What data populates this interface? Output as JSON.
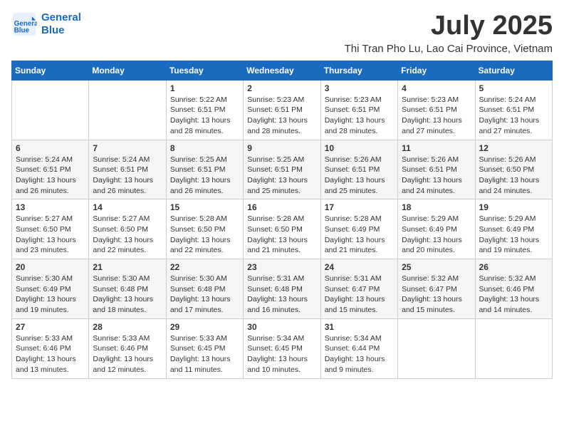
{
  "logo": {
    "line1": "General",
    "line2": "Blue"
  },
  "title": "July 2025",
  "subtitle": "Thi Tran Pho Lu, Lao Cai Province, Vietnam",
  "weekdays": [
    "Sunday",
    "Monday",
    "Tuesday",
    "Wednesday",
    "Thursday",
    "Friday",
    "Saturday"
  ],
  "weeks": [
    [
      {
        "day": "",
        "info": ""
      },
      {
        "day": "",
        "info": ""
      },
      {
        "day": "1",
        "info": "Sunrise: 5:22 AM\nSunset: 6:51 PM\nDaylight: 13 hours and 28 minutes."
      },
      {
        "day": "2",
        "info": "Sunrise: 5:23 AM\nSunset: 6:51 PM\nDaylight: 13 hours and 28 minutes."
      },
      {
        "day": "3",
        "info": "Sunrise: 5:23 AM\nSunset: 6:51 PM\nDaylight: 13 hours and 28 minutes."
      },
      {
        "day": "4",
        "info": "Sunrise: 5:23 AM\nSunset: 6:51 PM\nDaylight: 13 hours and 27 minutes."
      },
      {
        "day": "5",
        "info": "Sunrise: 5:24 AM\nSunset: 6:51 PM\nDaylight: 13 hours and 27 minutes."
      }
    ],
    [
      {
        "day": "6",
        "info": "Sunrise: 5:24 AM\nSunset: 6:51 PM\nDaylight: 13 hours and 26 minutes."
      },
      {
        "day": "7",
        "info": "Sunrise: 5:24 AM\nSunset: 6:51 PM\nDaylight: 13 hours and 26 minutes."
      },
      {
        "day": "8",
        "info": "Sunrise: 5:25 AM\nSunset: 6:51 PM\nDaylight: 13 hours and 26 minutes."
      },
      {
        "day": "9",
        "info": "Sunrise: 5:25 AM\nSunset: 6:51 PM\nDaylight: 13 hours and 25 minutes."
      },
      {
        "day": "10",
        "info": "Sunrise: 5:26 AM\nSunset: 6:51 PM\nDaylight: 13 hours and 25 minutes."
      },
      {
        "day": "11",
        "info": "Sunrise: 5:26 AM\nSunset: 6:51 PM\nDaylight: 13 hours and 24 minutes."
      },
      {
        "day": "12",
        "info": "Sunrise: 5:26 AM\nSunset: 6:50 PM\nDaylight: 13 hours and 24 minutes."
      }
    ],
    [
      {
        "day": "13",
        "info": "Sunrise: 5:27 AM\nSunset: 6:50 PM\nDaylight: 13 hours and 23 minutes."
      },
      {
        "day": "14",
        "info": "Sunrise: 5:27 AM\nSunset: 6:50 PM\nDaylight: 13 hours and 22 minutes."
      },
      {
        "day": "15",
        "info": "Sunrise: 5:28 AM\nSunset: 6:50 PM\nDaylight: 13 hours and 22 minutes."
      },
      {
        "day": "16",
        "info": "Sunrise: 5:28 AM\nSunset: 6:50 PM\nDaylight: 13 hours and 21 minutes."
      },
      {
        "day": "17",
        "info": "Sunrise: 5:28 AM\nSunset: 6:49 PM\nDaylight: 13 hours and 21 minutes."
      },
      {
        "day": "18",
        "info": "Sunrise: 5:29 AM\nSunset: 6:49 PM\nDaylight: 13 hours and 20 minutes."
      },
      {
        "day": "19",
        "info": "Sunrise: 5:29 AM\nSunset: 6:49 PM\nDaylight: 13 hours and 19 minutes."
      }
    ],
    [
      {
        "day": "20",
        "info": "Sunrise: 5:30 AM\nSunset: 6:49 PM\nDaylight: 13 hours and 19 minutes."
      },
      {
        "day": "21",
        "info": "Sunrise: 5:30 AM\nSunset: 6:48 PM\nDaylight: 13 hours and 18 minutes."
      },
      {
        "day": "22",
        "info": "Sunrise: 5:30 AM\nSunset: 6:48 PM\nDaylight: 13 hours and 17 minutes."
      },
      {
        "day": "23",
        "info": "Sunrise: 5:31 AM\nSunset: 6:48 PM\nDaylight: 13 hours and 16 minutes."
      },
      {
        "day": "24",
        "info": "Sunrise: 5:31 AM\nSunset: 6:47 PM\nDaylight: 13 hours and 15 minutes."
      },
      {
        "day": "25",
        "info": "Sunrise: 5:32 AM\nSunset: 6:47 PM\nDaylight: 13 hours and 15 minutes."
      },
      {
        "day": "26",
        "info": "Sunrise: 5:32 AM\nSunset: 6:46 PM\nDaylight: 13 hours and 14 minutes."
      }
    ],
    [
      {
        "day": "27",
        "info": "Sunrise: 5:33 AM\nSunset: 6:46 PM\nDaylight: 13 hours and 13 minutes."
      },
      {
        "day": "28",
        "info": "Sunrise: 5:33 AM\nSunset: 6:46 PM\nDaylight: 13 hours and 12 minutes."
      },
      {
        "day": "29",
        "info": "Sunrise: 5:33 AM\nSunset: 6:45 PM\nDaylight: 13 hours and 11 minutes."
      },
      {
        "day": "30",
        "info": "Sunrise: 5:34 AM\nSunset: 6:45 PM\nDaylight: 13 hours and 10 minutes."
      },
      {
        "day": "31",
        "info": "Sunrise: 5:34 AM\nSunset: 6:44 PM\nDaylight: 13 hours and 9 minutes."
      },
      {
        "day": "",
        "info": ""
      },
      {
        "day": "",
        "info": ""
      }
    ]
  ]
}
